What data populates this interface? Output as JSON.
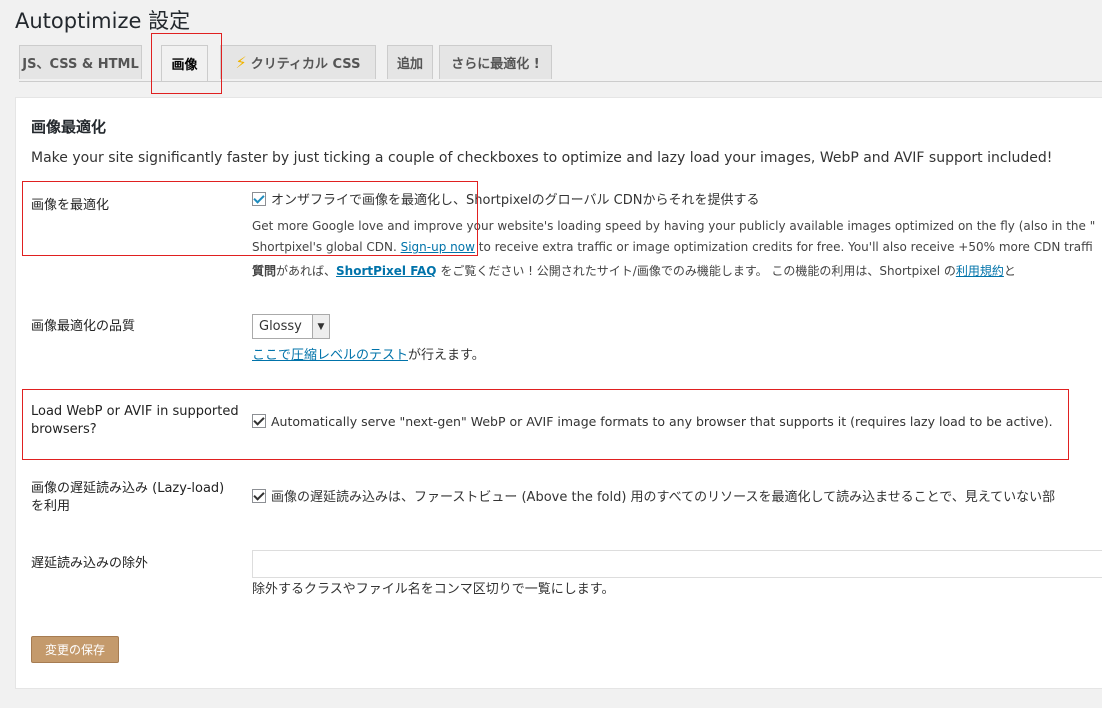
{
  "page_title": "Autoptimize 設定",
  "tabs": [
    {
      "label": "JS、CSS & HTML",
      "active": false
    },
    {
      "label": "画像",
      "active": true
    },
    {
      "label": "クリティカル CSS",
      "active": false,
      "icon": "lightning-bolt-icon"
    },
    {
      "label": "追加",
      "active": false
    },
    {
      "label": "さらに最適化 !",
      "active": false
    }
  ],
  "section": {
    "title": "画像最適化",
    "intro": "Make your site significantly faster by just ticking a couple of checkboxes to optimize and lazy load your images, WebP and AVIF support included!"
  },
  "optimize": {
    "label": "画像を最適化",
    "checked": true,
    "checkbox_text": "オンザフライで画像を最適化し、Shortpixelのグローバル CDNからそれを提供する",
    "desc_line1": "Get more Google love and improve your website's loading speed by having your publicly available images optimized on the fly (also in the \"",
    "desc_line2_pre": "Shortpixel's global CDN. ",
    "signup_link": "Sign-up now",
    "desc_line2_post": " to receive extra traffic or image optimization credits for free. You'll also receive +50% more CDN traffi",
    "faq_bold": "質問",
    "faq_pre": "があれば、",
    "faq_link": "ShortPixel FAQ",
    "faq_post": " をご覧ください ! 公開されたサイト/画像でのみ機能します。 この機能の利用は、Shortpixel の",
    "terms_link": "利用規約",
    "terms_post": "と"
  },
  "quality": {
    "label": "画像最適化の品質",
    "selected": "Glossy",
    "test_link": "ここで圧縮レベルのテスト",
    "test_post": "が行えます。"
  },
  "webp": {
    "label_line1": "Load WebP or AVIF in supported",
    "label_line2": "browsers?",
    "checked": true,
    "text": "Automatically serve \"next-gen\" WebP or AVIF image formats to any browser that supports it (requires lazy load to be active)."
  },
  "lazyload": {
    "label_line1": "画像の遅延読み込み (Lazy-load)",
    "label_line2": "を利用",
    "checked": true,
    "text": "画像の遅延読み込みは、ファーストビュー (Above the fold) 用のすべてのリソースを最適化して読み込ませることで、見えていない部"
  },
  "exclude": {
    "label": "遅延読み込みの除外",
    "value": "",
    "help": "除外するクラスやファイル名をコンマ区切りで一覧にします。"
  },
  "save_button": "変更の保存",
  "colors": {
    "highlight": "#e02020",
    "link": "#0073aa",
    "save_button": "#c49a6c",
    "bolt": "#f0b400"
  }
}
